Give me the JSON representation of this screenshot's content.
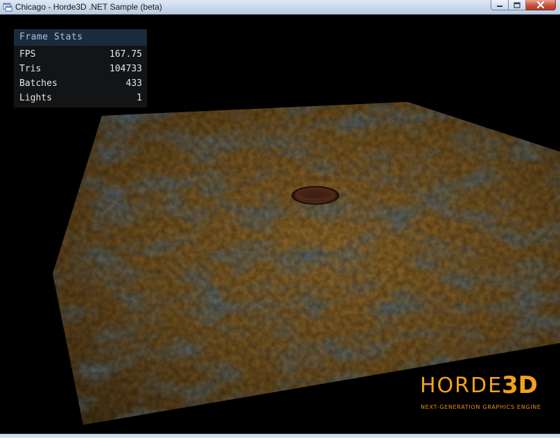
{
  "window": {
    "title": "Chicago - Horde3D .NET Sample (beta)",
    "icon": "app-window-icon",
    "controls": [
      "minimize-icon",
      "maximize-icon",
      "close-icon"
    ]
  },
  "stats": {
    "title": "Frame Stats",
    "rows": [
      {
        "label": "FPS",
        "value": "167.75"
      },
      {
        "label": "Tris",
        "value": "104733"
      },
      {
        "label": "Batches",
        "value": "433"
      },
      {
        "label": "Lights",
        "value": "1"
      }
    ]
  },
  "logo": {
    "word": "HORDE",
    "mark": "3D",
    "tagline": "NEXT-GENERATION GRAPHICS ENGINE",
    "color": "#f3a21c"
  },
  "colors": {
    "viewport_background": "#000000",
    "stats_header": "#1a2b3d",
    "terrain": "#7a5a24"
  }
}
